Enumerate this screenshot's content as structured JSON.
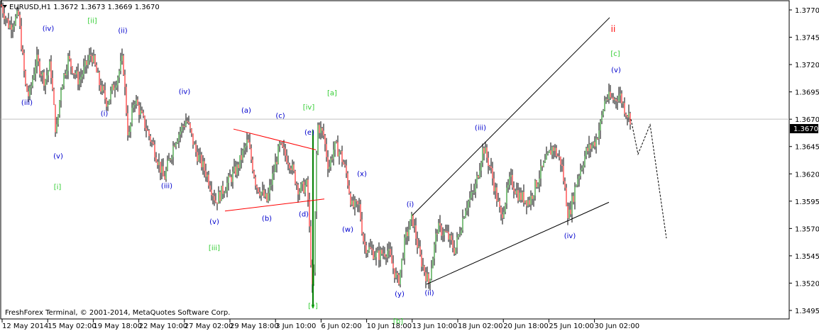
{
  "header": {
    "symbol_info": "EURUSD,H1  1.3672 1.3673 1.3669 1.3670"
  },
  "footer": {
    "copyright": "FreshForex Terminal, © 2001-2014, MetaQuotes Software Corp."
  },
  "colors": {
    "bull_candle": "#008000",
    "bear_candle": "#ff0000",
    "wick": "#000000",
    "wave_minor": "#0000cd",
    "wave_intermediate": "#32cd32",
    "wave_primary": "#ff0000",
    "triangle_lines": "#ff0000",
    "channel_lines": "#000000",
    "current_price_badge": "#000000"
  },
  "chart_data": {
    "type": "candlestick",
    "symbol": "EURUSD",
    "timeframe": "H1",
    "last_bar": {
      "open": 1.3672,
      "high": 1.3673,
      "low": 1.3669,
      "close": 1.367
    },
    "current_price": "1.3670",
    "ylim": [
      1.3485,
      1.379
    ],
    "y_ticks": [
      "1.3770",
      "1.3745",
      "1.3720",
      "1.3695",
      "1.3670",
      "1.3645",
      "1.3620",
      "1.3595",
      "1.3570",
      "1.3545",
      "1.3520",
      "1.3495"
    ],
    "x_ticks": [
      "12 May 2014",
      "15 May 02:00",
      "19 May 18:00",
      "22 May 10:00",
      "27 May 02:00",
      "29 May 18:00",
      "3 Jun 10:00",
      "6 Jun 02:00",
      "10 Jun 18:00",
      "13 Jun 10:00",
      "18 Jun 02:00",
      "20 Jun 18:00",
      "25 Jun 10:00",
      "30 Jun 02:00"
    ],
    "grid": false,
    "price_path": [
      [
        0,
        1.3775
      ],
      [
        12,
        1.3755
      ],
      [
        25,
        1.3765
      ],
      [
        35,
        1.37
      ],
      [
        40,
        1.369
      ],
      [
        50,
        1.3725
      ],
      [
        62,
        1.3705
      ],
      [
        70,
        1.372
      ],
      [
        78,
        1.3655
      ],
      [
        85,
        1.37
      ],
      [
        95,
        1.3725
      ],
      [
        110,
        1.3705
      ],
      [
        128,
        1.373
      ],
      [
        140,
        1.37
      ],
      [
        150,
        1.3685
      ],
      [
        165,
        1.371
      ],
      [
        172,
        1.3725
      ],
      [
        180,
        1.365
      ],
      [
        188,
        1.369
      ],
      [
        200,
        1.367
      ],
      [
        215,
        1.3645
      ],
      [
        230,
        1.3615
      ],
      [
        245,
        1.365
      ],
      [
        262,
        1.367
      ],
      [
        275,
        1.364
      ],
      [
        290,
        1.362
      ],
      [
        303,
        1.3595
      ],
      [
        318,
        1.361
      ],
      [
        333,
        1.3625
      ],
      [
        348,
        1.365
      ],
      [
        360,
        1.361
      ],
      [
        375,
        1.3595
      ],
      [
        393,
        1.3645
      ],
      [
        408,
        1.363
      ],
      [
        420,
        1.3605
      ],
      [
        432,
        1.361
      ],
      [
        440,
        1.35
      ],
      [
        446,
        1.3665
      ],
      [
        455,
        1.3655
      ],
      [
        462,
        1.3625
      ],
      [
        470,
        1.3645
      ],
      [
        478,
        1.364
      ],
      [
        487,
        1.362
      ],
      [
        495,
        1.359
      ],
      [
        505,
        1.359
      ],
      [
        512,
        1.3555
      ],
      [
        530,
        1.3545
      ],
      [
        545,
        1.355
      ],
      [
        560,
        1.352
      ],
      [
        570,
        1.356
      ],
      [
        580,
        1.358
      ],
      [
        590,
        1.3545
      ],
      [
        603,
        1.352
      ],
      [
        615,
        1.357
      ],
      [
        628,
        1.3565
      ],
      [
        640,
        1.355
      ],
      [
        655,
        1.359
      ],
      [
        668,
        1.3605
      ],
      [
        680,
        1.3645
      ],
      [
        690,
        1.3625
      ],
      [
        705,
        1.358
      ],
      [
        718,
        1.3615
      ],
      [
        730,
        1.36
      ],
      [
        745,
        1.3595
      ],
      [
        760,
        1.362
      ],
      [
        778,
        1.3645
      ],
      [
        790,
        1.363
      ],
      [
        800,
        1.358
      ],
      [
        812,
        1.3615
      ],
      [
        825,
        1.364
      ],
      [
        838,
        1.365
      ],
      [
        845,
        1.3665
      ],
      [
        852,
        1.369
      ],
      [
        865,
        1.3688
      ],
      [
        872,
        1.3693
      ],
      [
        880,
        1.3678
      ],
      [
        888,
        1.367
      ]
    ],
    "projection_path": [
      [
        888,
        1.367
      ],
      [
        898,
        1.3638
      ],
      [
        915,
        1.3665
      ],
      [
        938,
        1.3561
      ]
    ],
    "triangle_lines": [
      {
        "from": [
          328,
          1.3661
        ],
        "to": [
          444,
          1.3642
        ]
      },
      {
        "from": [
          316,
          1.3586
        ],
        "to": [
          456,
          1.3597
        ]
      }
    ],
    "channel_lines": [
      {
        "from": [
          580,
          1.3582
        ],
        "to": [
          858,
          1.3763
        ]
      },
      {
        "from": [
          600,
          1.3519
        ],
        "to": [
          857,
          1.3594
        ]
      }
    ],
    "wave_labels": [
      {
        "text": "(iv)",
        "bar": 67,
        "price": 1.3751,
        "degree": "minor"
      },
      {
        "text": "[ii]",
        "bar": 129,
        "price": 1.3758,
        "degree": "intermediate"
      },
      {
        "text": "(ii)",
        "bar": 172,
        "price": 1.3749,
        "degree": "minor"
      },
      {
        "text": "(iii)",
        "bar": 37,
        "price": 1.3683,
        "degree": "minor"
      },
      {
        "text": "(i)",
        "bar": 146,
        "price": 1.3673,
        "degree": "minor"
      },
      {
        "text": "(iv)",
        "bar": 259,
        "price": 1.3693,
        "degree": "minor"
      },
      {
        "text": "(v)",
        "bar": 81,
        "price": 1.3634,
        "degree": "minor"
      },
      {
        "text": "[i]",
        "bar": 80,
        "price": 1.3606,
        "degree": "intermediate"
      },
      {
        "text": "(iii)",
        "bar": 234,
        "price": 1.3607,
        "degree": "minor"
      },
      {
        "text": "(a)",
        "bar": 346,
        "price": 1.3676,
        "degree": "minor"
      },
      {
        "text": "(c)",
        "bar": 394,
        "price": 1.3671,
        "degree": "minor"
      },
      {
        "text": "[iv]",
        "bar": 434,
        "price": 1.3679,
        "degree": "intermediate"
      },
      {
        "text": "[a]",
        "bar": 467,
        "price": 1.3692,
        "degree": "intermediate"
      },
      {
        "text": "(e)",
        "bar": 435,
        "price": 1.3656,
        "degree": "minor"
      },
      {
        "text": "(x)",
        "bar": 509,
        "price": 1.3618,
        "degree": "minor"
      },
      {
        "text": "(v)",
        "bar": 301,
        "price": 1.3574,
        "degree": "minor"
      },
      {
        "text": "(b)",
        "bar": 375,
        "price": 1.3577,
        "degree": "minor"
      },
      {
        "text": "(d)",
        "bar": 427,
        "price": 1.3581,
        "degree": "minor"
      },
      {
        "text": "(w)",
        "bar": 489,
        "price": 1.3567,
        "degree": "minor"
      },
      {
        "text": "[iii]",
        "bar": 301,
        "price": 1.355,
        "degree": "intermediate"
      },
      {
        "text": "(i)",
        "bar": 577,
        "price": 1.359,
        "degree": "minor"
      },
      {
        "text": "(iii)",
        "bar": 676,
        "price": 1.366,
        "degree": "minor"
      },
      {
        "text": "(y)",
        "bar": 562,
        "price": 1.3508,
        "degree": "minor"
      },
      {
        "text": "(ii)",
        "bar": 604,
        "price": 1.3509,
        "degree": "minor"
      },
      {
        "text": "(iv)",
        "bar": 802,
        "price": 1.3561,
        "degree": "minor"
      },
      {
        "text": "[v]",
        "bar": 440,
        "price": 1.3497,
        "degree": "intermediate"
      },
      {
        "text": "[b]",
        "bar": 560,
        "price": 1.3483,
        "degree": "intermediate"
      },
      {
        "text": "ii",
        "bar": 863,
        "price": 1.375,
        "degree": "primary"
      },
      {
        "text": "[c]",
        "bar": 866,
        "price": 1.3728,
        "degree": "intermediate"
      },
      {
        "text": "(v)",
        "bar": 867,
        "price": 1.3713,
        "degree": "minor"
      }
    ]
  }
}
